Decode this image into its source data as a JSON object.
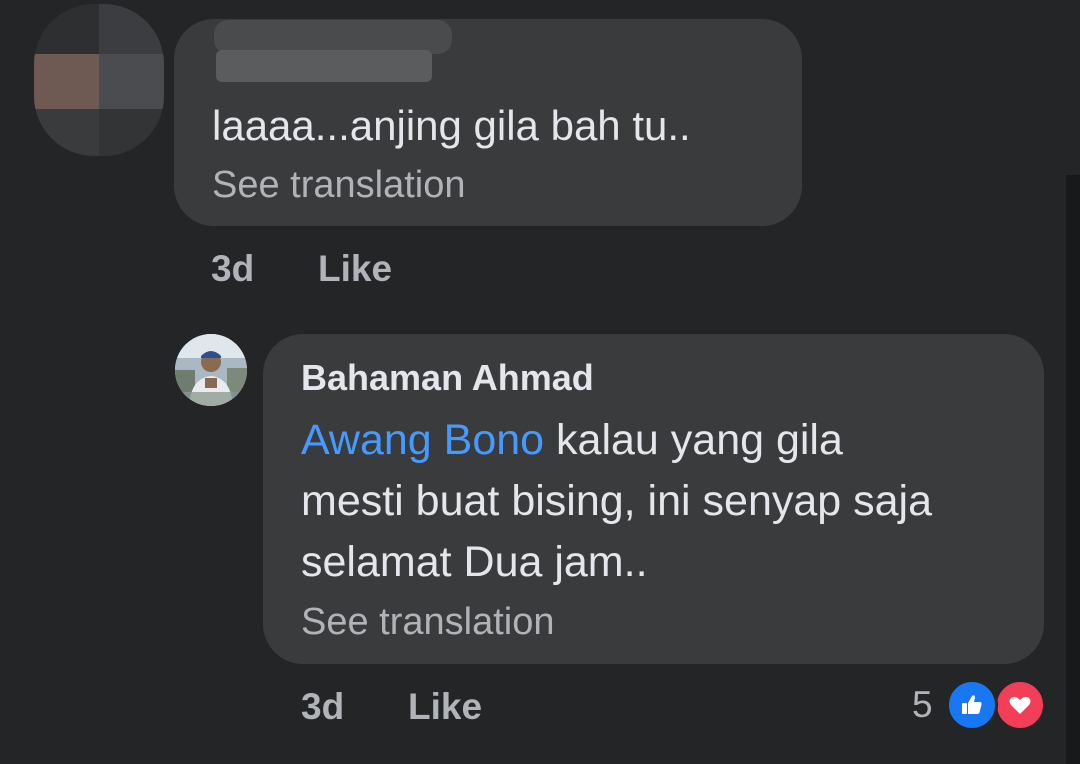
{
  "comments": [
    {
      "author": "",
      "text": "laaaa...anjing gila bah tu..",
      "see_translation": "See translation",
      "time": "3d",
      "like": "Like"
    },
    {
      "author": "Bahaman Ahmad",
      "mention": "Awang Bono",
      "text_line1": "kalau yang gila",
      "text_line2": "mesti buat bising, ini senyap saja",
      "text_line3": "selamat Dua jam..",
      "see_translation": "See translation",
      "time": "3d",
      "like": "Like",
      "reaction_count": "5",
      "reactions": [
        "like-icon",
        "love-icon"
      ]
    }
  ],
  "colors": {
    "background": "#242526",
    "bubble": "#3a3b3c",
    "mention": "#4599ff",
    "secondary_text": "#b0b3b8",
    "like_blue": "#1877f2",
    "love_red": "#f33e58"
  }
}
